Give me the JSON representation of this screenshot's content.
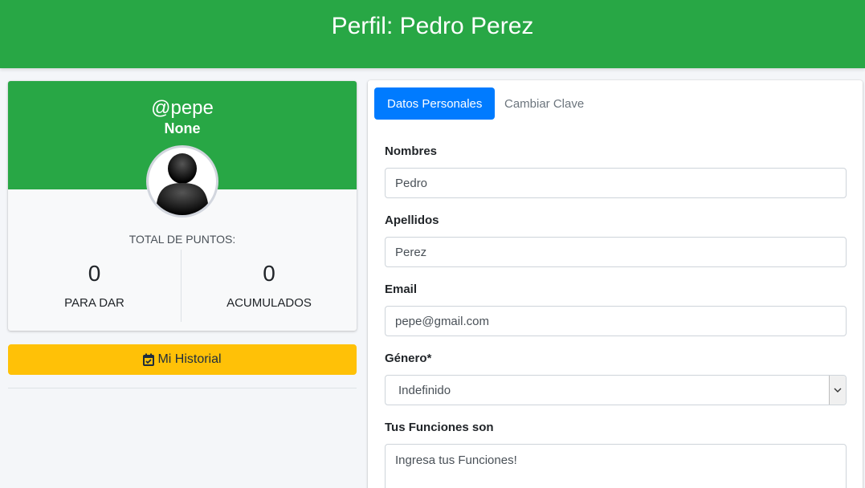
{
  "header": {
    "title": "Perfil: Pedro Perez",
    "color": "#28a745"
  },
  "profile": {
    "username": "@pepe",
    "role": "None",
    "points_title": "TOTAL DE PUNTOS:",
    "stats": [
      {
        "value": "0",
        "label": "PARA DAR"
      },
      {
        "value": "0",
        "label": "ACUMULADOS"
      }
    ],
    "avatar_icon": "user-silhouette-icon"
  },
  "history_button": {
    "label": "Mi Historial",
    "icon": "calendar-check-icon",
    "color": "#ffc107"
  },
  "tabs": [
    {
      "label": "Datos Personales",
      "active": true
    },
    {
      "label": "Cambiar Clave",
      "active": false
    }
  ],
  "form": {
    "nombres": {
      "label": "Nombres",
      "value": "Pedro"
    },
    "apellidos": {
      "label": "Apellidos",
      "value": "Perez"
    },
    "email": {
      "label": "Email",
      "value": "pepe@gmail.com"
    },
    "genero": {
      "label": "Género*",
      "selected": "Indefinido"
    },
    "funciones": {
      "label": "Tus Funciones son",
      "placeholder": "Ingresa tus Funciones!"
    }
  },
  "colors": {
    "accent": "#007bff",
    "success": "#28a745",
    "warning": "#ffc107"
  }
}
